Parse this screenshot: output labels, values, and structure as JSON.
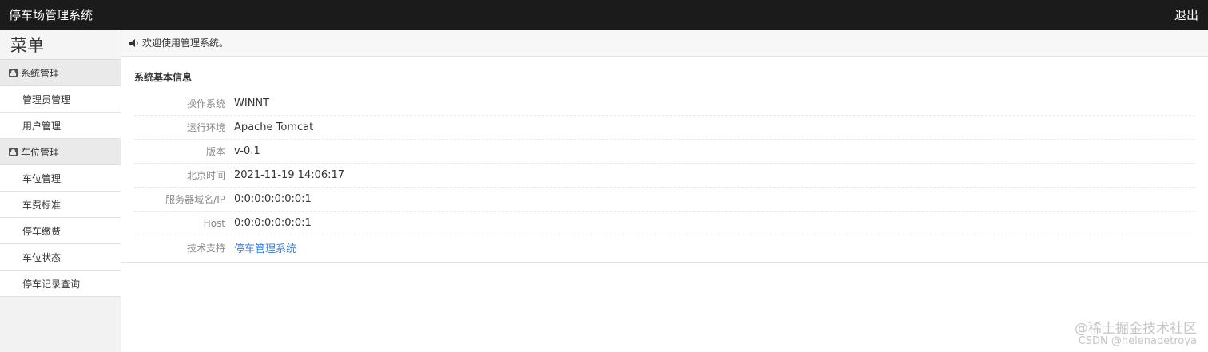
{
  "header": {
    "title": "停车场管理系统",
    "logout_label": "退出"
  },
  "sidebar": {
    "menu_title": "菜单",
    "groups": [
      {
        "label": "系统管理",
        "items": [
          {
            "label": "管理员管理"
          },
          {
            "label": "用户管理"
          }
        ]
      },
      {
        "label": "车位管理",
        "items": [
          {
            "label": "车位管理"
          },
          {
            "label": "车费标准"
          },
          {
            "label": "停车缴费"
          },
          {
            "label": "车位状态"
          },
          {
            "label": "停车记录查询"
          }
        ]
      }
    ]
  },
  "main": {
    "welcome_text": "欢迎使用管理系统。",
    "panel_title": "系统基本信息",
    "info": [
      {
        "label": "操作系统",
        "value": "WINNT"
      },
      {
        "label": "运行环境",
        "value": "Apache Tomcat"
      },
      {
        "label": "版本",
        "value": "v-0.1"
      },
      {
        "label": "北京时间",
        "value": "2021-11-19 14:06:17"
      },
      {
        "label": "服务器域名/IP",
        "value": "0:0:0:0:0:0:0:1"
      },
      {
        "label": "Host",
        "value": "0:0:0:0:0:0:0:1"
      },
      {
        "label": "技术支持",
        "value": "停车管理系统"
      }
    ]
  },
  "watermark": {
    "line1": "@稀土掘金技术社区",
    "line2": "CSDN @helenadetroya"
  },
  "colors": {
    "topbar": "#1b1b1b",
    "link": "#3a7bd5",
    "sidebar_bg": "#f2f2f2"
  }
}
